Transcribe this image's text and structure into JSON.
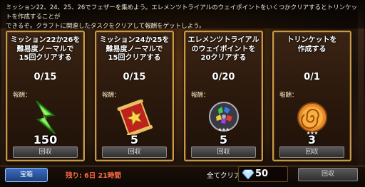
{
  "banner": {
    "line1": "ミッション22、24、25、26でフェザーを集めよう。エレメンツトライアルのウェイポイントをいくつかクリアするとトリンケットを作成することが",
    "line2": "できるぞ。クラフトに関連したタスクをクリアして報酬をゲットしよう。"
  },
  "cards": [
    {
      "title": [
        "ミッション22か26を",
        "難易度ノーマルで",
        "15回クリアする"
      ],
      "progress": "0/15",
      "reward_label": "報酬：",
      "reward_icon": "green-feather-icon",
      "reward_count": "150",
      "collect_label": "回収"
    },
    {
      "title": [
        "ミッション24か25を",
        "難易度ノーマルで",
        "15回クリアする"
      ],
      "progress": "0/15",
      "reward_label": "報酬：",
      "reward_icon": "red-star-scroll-icon",
      "reward_count": "5",
      "collect_label": "回収"
    },
    {
      "title": [
        "エレメンツトライアル",
        "のウェイポイントを",
        "20クリアする"
      ],
      "progress": "0/20",
      "reward_label": "報酬：",
      "reward_icon": "element-gem-orb-icon",
      "reward_count": "5",
      "collect_label": "回収"
    },
    {
      "title": [
        "トリンケットを",
        "作成する"
      ],
      "progress": "0/1",
      "reward_label": "報酬：",
      "reward_icon": "swirl-trinket-icon",
      "reward_count": "3",
      "collect_label": "回収"
    }
  ],
  "footer": {
    "treasure_label": "宝箱",
    "remaining": "残り: 6日 21時間",
    "allclear_label": "全てクリア:",
    "allclear_count": "50",
    "allclear_icon": "diamond-icon",
    "collect_label": "回収"
  }
}
